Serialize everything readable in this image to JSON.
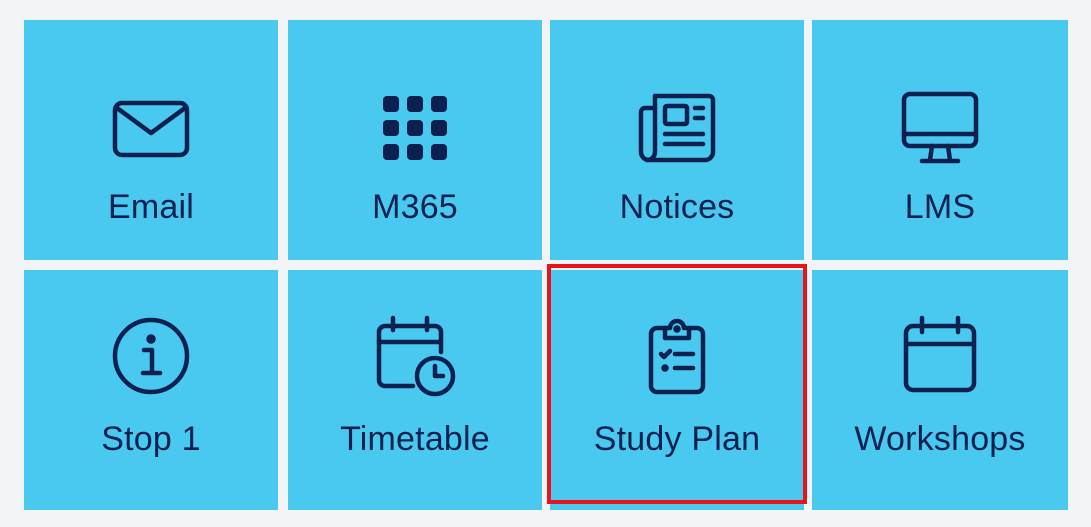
{
  "tiles": [
    {
      "label": "Email",
      "icon": "envelope-icon"
    },
    {
      "label": "M365",
      "icon": "app-grid-icon"
    },
    {
      "label": "Notices",
      "icon": "newspaper-icon"
    },
    {
      "label": "LMS",
      "icon": "monitor-icon"
    },
    {
      "label": "Stop 1",
      "icon": "info-icon"
    },
    {
      "label": "Timetable",
      "icon": "calendar-clock-icon"
    },
    {
      "label": "Study Plan",
      "icon": "clipboard-checklist-icon"
    },
    {
      "label": "Workshops",
      "icon": "calendar-icon"
    }
  ],
  "selected_tile": "Study Plan",
  "colors": {
    "tile_background": "#49c8f0",
    "icon_and_text": "#0c2150",
    "selection_outline": "#e8141b",
    "page_background": "#f2f4f7"
  }
}
